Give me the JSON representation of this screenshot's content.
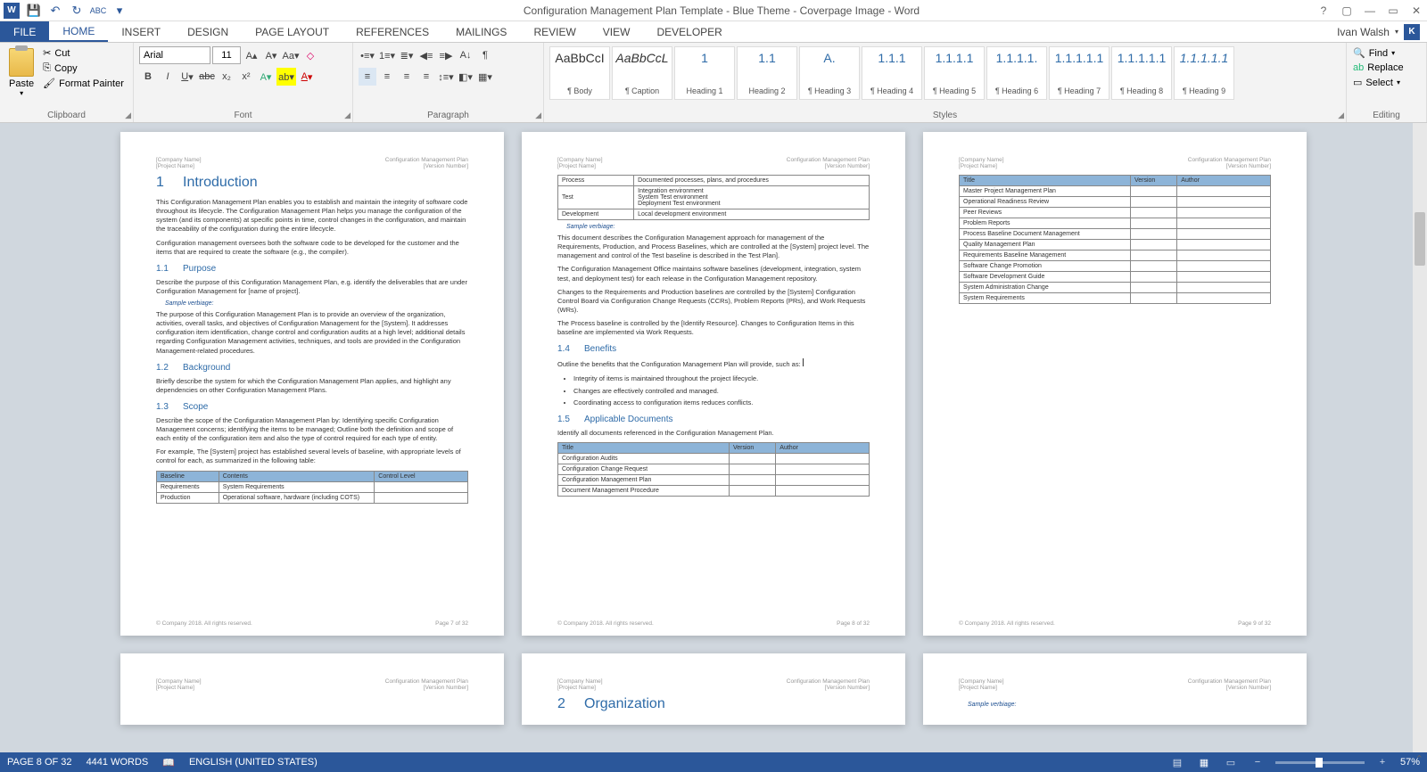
{
  "title": "Configuration Management Plan Template - Blue Theme - Coverpage Image - Word",
  "user": {
    "name": "Ivan Walsh",
    "badge": "K"
  },
  "tabs": [
    "FILE",
    "HOME",
    "INSERT",
    "DESIGN",
    "PAGE LAYOUT",
    "REFERENCES",
    "MAILINGS",
    "REVIEW",
    "VIEW",
    "DEVELOPER"
  ],
  "ribbon": {
    "clipboard": {
      "label": "Clipboard",
      "paste": "Paste",
      "cut": "Cut",
      "copy": "Copy",
      "format_painter": "Format Painter"
    },
    "font": {
      "label": "Font",
      "name": "Arial",
      "size": "11"
    },
    "paragraph": {
      "label": "Paragraph"
    },
    "styles": {
      "label": "Styles",
      "items": [
        {
          "prev": "AaBbCcI",
          "name": "¶ Body"
        },
        {
          "prev": "AaBbCcL",
          "name": "¶ Caption",
          "italic": true
        },
        {
          "prev": "1",
          "name": "Heading 1",
          "blue": true
        },
        {
          "prev": "1.1",
          "name": "Heading 2",
          "blue": true
        },
        {
          "prev": "A.",
          "name": "¶ Heading 3",
          "blue": true
        },
        {
          "prev": "1.1.1",
          "name": "¶ Heading 4",
          "blue": true
        },
        {
          "prev": "1.1.1.1",
          "name": "¶ Heading 5",
          "blue": true
        },
        {
          "prev": "1.1.1.1.",
          "name": "¶ Heading 6",
          "blue": true
        },
        {
          "prev": "1.1.1.1.1",
          "name": "¶ Heading 7",
          "blue": true
        },
        {
          "prev": "1.1.1.1.1",
          "name": "¶ Heading 8",
          "blue": true
        },
        {
          "prev": "1.1.1.1.1",
          "name": "¶ Heading 9",
          "blue": true,
          "italic": true
        }
      ]
    },
    "editing": {
      "label": "Editing",
      "find": "Find",
      "replace": "Replace",
      "select": "Select"
    }
  },
  "doc": {
    "hdr_left1": "[Company Name]",
    "hdr_left2": "[Project Name]",
    "hdr_right1": "Configuration Management Plan",
    "hdr_right2": "[Version Number]",
    "ftr_left": "© Company 2018. All rights reserved.",
    "p7": {
      "ftr_right": "Page 7 of 32",
      "h1_intro": "Introduction",
      "p_intro1": "This Configuration Management Plan enables you to establish and maintain the integrity of software code throughout its lifecycle. The Configuration Management Plan helps you manage the configuration of the system (and its components) at specific points in time, control changes in the configuration, and maintain the traceability of the configuration during the entire lifecycle.",
      "p_intro2": "Configuration management oversees both the software code to be developed for the customer and the items that are required to create the software (e.g., the compiler).",
      "h2_purpose": "Purpose",
      "p_purpose1": "Describe the purpose of this Configuration Management Plan, e.g. identify the deliverables that are under Configuration Management for [name of project].",
      "verb": "Sample verbiage:",
      "p_purpose2": "The purpose of this Configuration Management Plan is to provide an overview of the organization, activities, overall tasks, and objectives of Configuration Management for the [System].  It addresses configuration item identification, change control and configuration audits at a high level; additional details regarding Configuration Management activities, techniques, and tools are provided in the Configuration Management-related procedures.",
      "h2_bg": "Background",
      "p_bg": "Briefly describe the system for which the Configuration Management Plan applies, and highlight any dependencies on other Configuration Management Plans.",
      "h2_scope": "Scope",
      "p_scope1": "Describe the scope of the Configuration Management Plan by: Identifying specific Configuration Management concerns; identifying the items to be managed; Outline both the definition and scope of each entity of the configuration item and also the type of control required for each type of entity.",
      "p_scope2": "For example, The [System] project has established several levels of baseline, with appropriate levels of control for each, as summarized in the following table:",
      "tbl_baseline": {
        "headers": [
          "Baseline",
          "Contents",
          "Control Level"
        ],
        "rows": [
          [
            "Requirements",
            "System Requirements",
            ""
          ],
          [
            "Production",
            "Operational software, hardware (including COTS)",
            ""
          ]
        ]
      }
    },
    "p8": {
      "ftr_right": "Page 8 of 32",
      "tbl_env": {
        "rows": [
          [
            "Process",
            "Documented processes, plans, and procedures"
          ],
          [
            "Test",
            "Integration environment\nSystem Test environment\nDeployment Test environment"
          ],
          [
            "Development",
            "Local development environment"
          ]
        ]
      },
      "verb": "Sample verbiage:",
      "p1": "This document describes the Configuration Management approach for management of the Requirements, Production, and Process Baselines, which are controlled at the [System] project level. The management and control of the Test baseline is described in the Test Plan].",
      "p2": "The Configuration Management Office maintains software baselines (development, integration, system test, and deployment test) for each release in the Configuration Management repository.",
      "p3": "Changes to the Requirements and Production baselines are controlled by the [System] Configuration Control Board via Configuration Change Requests (CCRs), Problem Reports (PRs), and Work Requests (WRs).",
      "p4": "The Process baseline is controlled by the [Identify Resource]. Changes to Configuration Items in this baseline are implemented via Work Requests.",
      "h2_benefits": "Benefits",
      "p_benefits": "Outline the benefits that the Configuration Management Plan will provide, such as:",
      "bul": [
        "Integrity of items is maintained throughout the project lifecycle.",
        "Changes are effectively controlled and managed.",
        "Coordinating access to configuration items reduces conflicts."
      ],
      "h2_docs": "Applicable Documents",
      "p_docs": "Identify all documents referenced in the Configuration Management Plan.",
      "tbl_docs": {
        "headers": [
          "Title",
          "Version",
          "Author"
        ],
        "rows": [
          [
            "Configuration Audits",
            "",
            ""
          ],
          [
            "Configuration Change Request",
            "",
            ""
          ],
          [
            "Configuration Management Plan",
            "",
            ""
          ],
          [
            "Document Management Procedure",
            "",
            ""
          ]
        ]
      }
    },
    "p9": {
      "ftr_right": "Page 9 of 32",
      "tbl": {
        "headers": [
          "Title",
          "Version",
          "Author"
        ],
        "rows": [
          [
            "Master Project Management Plan",
            "",
            ""
          ],
          [
            "Operational Readiness Review",
            "",
            ""
          ],
          [
            "Peer Reviews",
            "",
            ""
          ],
          [
            "Problem Reports",
            "",
            ""
          ],
          [
            "Process Baseline Document Management",
            "",
            ""
          ],
          [
            "Quality Management Plan",
            "",
            ""
          ],
          [
            "Requirements Baseline Management",
            "",
            ""
          ],
          [
            "Software Change Promotion",
            "",
            ""
          ],
          [
            "Software Development Guide",
            "",
            ""
          ],
          [
            "System Administration Change",
            "",
            ""
          ],
          [
            "System Requirements",
            "",
            ""
          ]
        ]
      }
    },
    "p11": {
      "h1_org": "Organization"
    },
    "p12": {
      "verb": "Sample verbiage:"
    }
  },
  "status": {
    "page": "PAGE 8 OF 32",
    "words": "4441 WORDS",
    "lang": "ENGLISH (UNITED STATES)",
    "zoom": "57%"
  }
}
